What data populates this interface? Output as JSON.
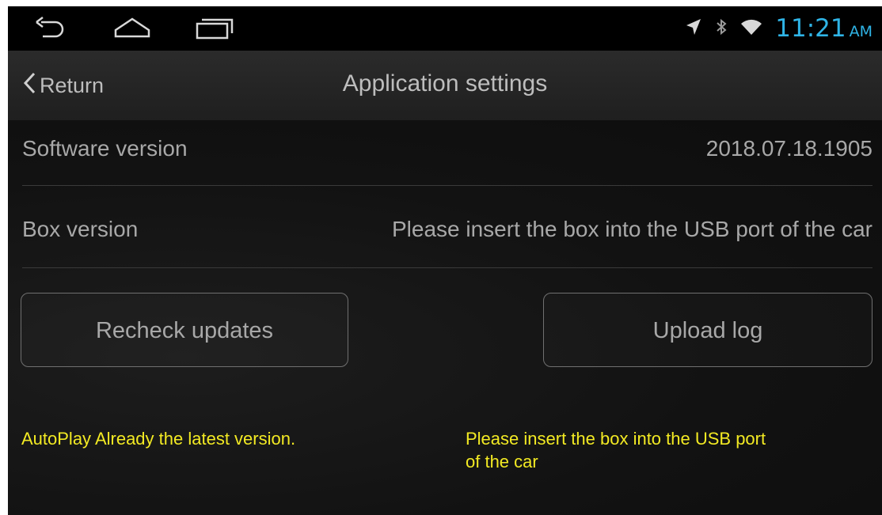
{
  "colors": {
    "accent_clock": "#2fb4e6",
    "message": "#f3ea23",
    "text": "#a8a8a8"
  },
  "status_bar": {
    "nav_icons": [
      "back-icon",
      "home-icon",
      "recent-apps-icon"
    ],
    "status_icons": [
      "location-arrow-icon",
      "bluetooth-icon",
      "wifi-icon"
    ],
    "time": "11:21",
    "ampm": "AM"
  },
  "header": {
    "return_label": "Return",
    "title": "Application settings"
  },
  "rows": [
    {
      "label": "Software version",
      "value": "2018.07.18.1905"
    },
    {
      "label": "Box version",
      "value": "Please insert the box into the USB port of the car"
    }
  ],
  "buttons": {
    "recheck": "Recheck updates",
    "upload": "Upload log"
  },
  "messages": {
    "recheck_status": "AutoPlay Already the latest version.",
    "upload_status_line1": "Please insert the box into the USB port",
    "upload_status_line2": "of the car"
  }
}
